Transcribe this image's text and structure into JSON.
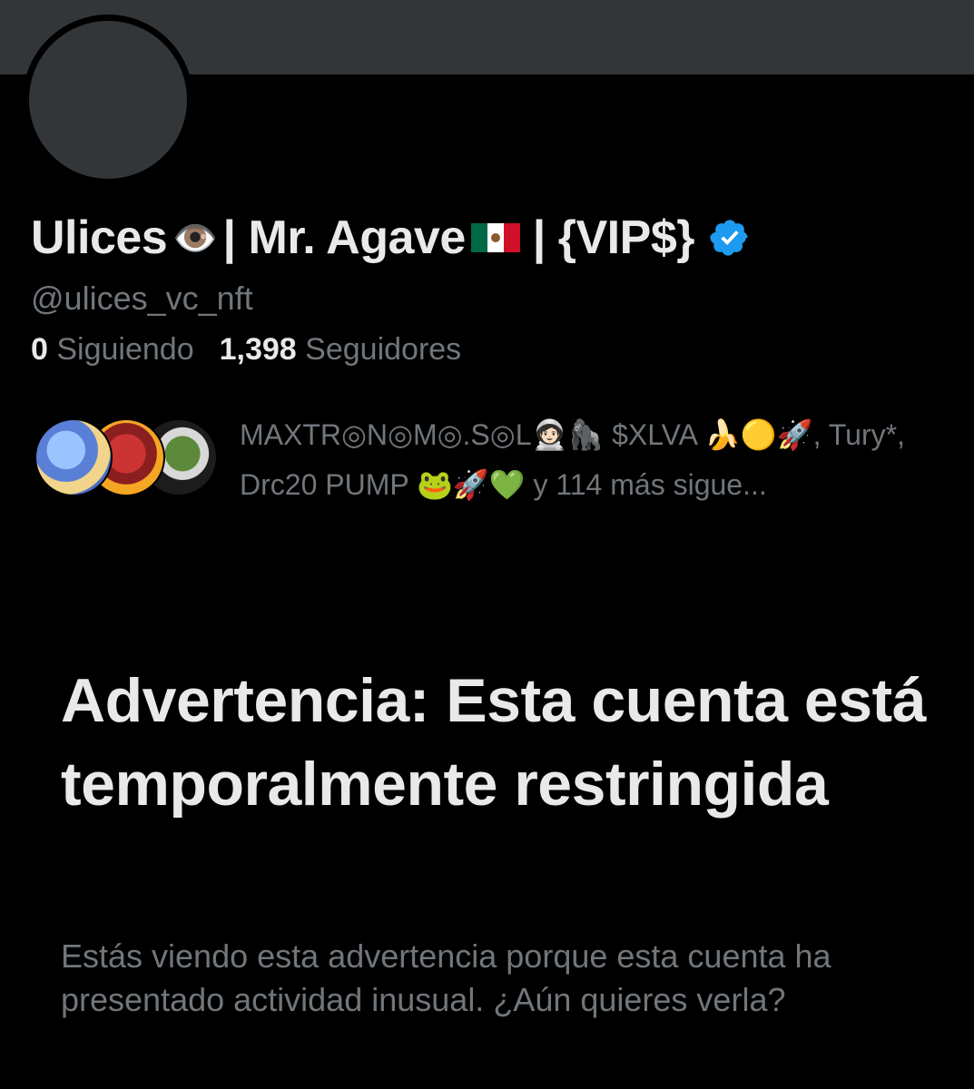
{
  "profile": {
    "name_first": "Ulices",
    "name_eye_emoji": "👁️",
    "name_mid": "| Mr. Agave",
    "name_end": "| {VIP$}",
    "handle": "@ulices_vc_nft",
    "verified_color": "#1d9bf0"
  },
  "stats": {
    "following_count": "0",
    "following_label": "Siguiendo",
    "followers_count": "1,398",
    "followers_label": "Seguidores"
  },
  "followed_by": {
    "text": "MAXTR◎N◎M◎.S◎L🧑🏻‍🚀🦍 $XLVA 🍌🟡🚀, Tury*, Drc20 PUMP 🐸🚀💚 y 114 más sigue..."
  },
  "warning": {
    "title": "Advertencia: Esta cuenta está temporalmente restringida",
    "body": "Estás viendo esta advertencia porque esta cuenta ha presentado actividad inusual. ¿Aún quieres verla?"
  }
}
